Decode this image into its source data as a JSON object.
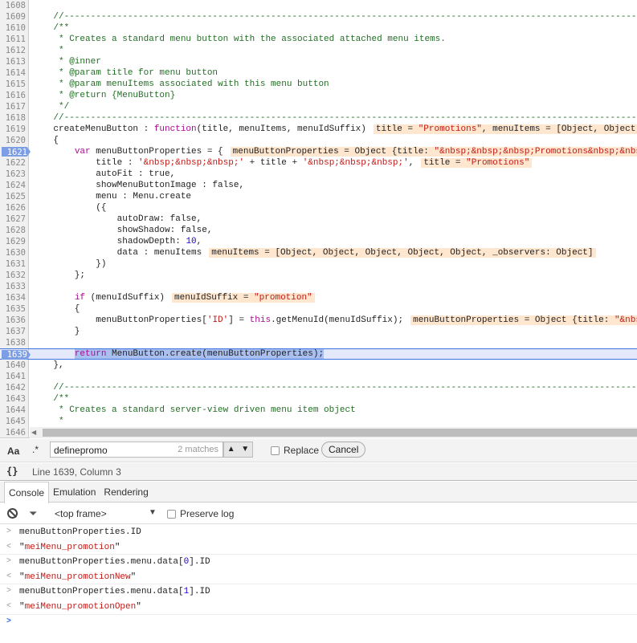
{
  "editor": {
    "lines": [
      {
        "num": "1608",
        "code": []
      },
      {
        "num": "1609",
        "code": [
          [
            "    //-------------------------------------------------------------------------------------------------------------------",
            "c"
          ]
        ]
      },
      {
        "num": "1610",
        "code": [
          [
            "    /**",
            "c"
          ]
        ]
      },
      {
        "num": "1611",
        "code": [
          [
            "     * Creates a standard menu button with the associated attached menu items.",
            "c"
          ]
        ]
      },
      {
        "num": "1612",
        "code": [
          [
            "     *",
            "c"
          ]
        ]
      },
      {
        "num": "1613",
        "code": [
          [
            "     * @inner",
            "c"
          ]
        ]
      },
      {
        "num": "1614",
        "code": [
          [
            "     * @param title for menu button",
            "c"
          ]
        ]
      },
      {
        "num": "1615",
        "code": [
          [
            "     * @param menuItems associated with this menu button",
            "c"
          ]
        ]
      },
      {
        "num": "1616",
        "code": [
          [
            "     * @return {MenuButton}",
            "c"
          ]
        ]
      },
      {
        "num": "1617",
        "code": [
          [
            "     */",
            "c"
          ]
        ]
      },
      {
        "num": "1618",
        "code": [
          [
            "    //-------------------------------------------------------------------------------------------------------------------",
            "c"
          ]
        ]
      },
      {
        "num": "1619",
        "code": [
          [
            "    createMenuButton : ",
            "p"
          ],
          [
            "function",
            "k"
          ],
          [
            "(title, menuItems, menuIdSuffix)",
            "p"
          ]
        ],
        "value": [
          [
            "title = ",
            "p"
          ],
          [
            "\"Promotions\"",
            "s"
          ],
          [
            ", menuItems = [Object, Object, Object, Object, Object, _observers: Object]",
            "p"
          ]
        ]
      },
      {
        "num": "1620",
        "code": [
          [
            "    {",
            "p"
          ]
        ]
      },
      {
        "num": "1621",
        "breakpoint": true,
        "code": [
          [
            "        ",
            "p"
          ],
          [
            "var",
            "k"
          ],
          [
            " menuButtonProperties = {",
            "p"
          ]
        ],
        "value": [
          [
            "menuButtonProperties = Object {title: ",
            "p"
          ],
          [
            "\"&nbsp;&nbsp;&nbsp;Promotions&nbsp;&nbsp;&nbsp;\"",
            "s"
          ]
        ]
      },
      {
        "num": "1622",
        "code": [
          [
            "            title : ",
            "p"
          ],
          [
            "'&nbsp;&nbsp;&nbsp;'",
            "s"
          ],
          [
            " + title + ",
            "p"
          ],
          [
            "'&nbsp;&nbsp;&nbsp;'",
            "s"
          ],
          [
            ",",
            "p"
          ]
        ],
        "value": [
          [
            "title = ",
            "p"
          ],
          [
            "\"Promotions\"",
            "s"
          ]
        ]
      },
      {
        "num": "1623",
        "code": [
          [
            "            autoFit : true,",
            "p"
          ]
        ]
      },
      {
        "num": "1624",
        "code": [
          [
            "            showMenuButtonImage : false,",
            "p"
          ]
        ]
      },
      {
        "num": "1625",
        "code": [
          [
            "            menu : Menu.create",
            "p"
          ]
        ]
      },
      {
        "num": "1626",
        "code": [
          [
            "            ({",
            "p"
          ]
        ]
      },
      {
        "num": "1627",
        "code": [
          [
            "                autoDraw: false,",
            "p"
          ]
        ]
      },
      {
        "num": "1628",
        "code": [
          [
            "                showShadow: false,",
            "p"
          ]
        ]
      },
      {
        "num": "1629",
        "code": [
          [
            "                shadowDepth: ",
            "p"
          ],
          [
            "10",
            "n"
          ],
          [
            ",",
            "p"
          ]
        ]
      },
      {
        "num": "1630",
        "code": [
          [
            "                data : menuItems",
            "p"
          ]
        ],
        "value": [
          [
            "menuItems = [Object, Object, Object, Object, Object, _observers: Object]",
            "p"
          ]
        ]
      },
      {
        "num": "1631",
        "code": [
          [
            "            })",
            "p"
          ]
        ]
      },
      {
        "num": "1632",
        "code": [
          [
            "        };",
            "p"
          ]
        ]
      },
      {
        "num": "1633",
        "code": []
      },
      {
        "num": "1634",
        "code": [
          [
            "        ",
            "p"
          ],
          [
            "if",
            "k"
          ],
          [
            " (menuIdSuffix)",
            "p"
          ]
        ],
        "value": [
          [
            "menuIdSuffix = ",
            "p"
          ],
          [
            "\"promotion\"",
            "s"
          ]
        ]
      },
      {
        "num": "1635",
        "code": [
          [
            "        {",
            "p"
          ]
        ]
      },
      {
        "num": "1636",
        "code": [
          [
            "            menuButtonProperties[",
            "p"
          ],
          [
            "'ID'",
            "s"
          ],
          [
            "] = ",
            "p"
          ],
          [
            "this",
            "k"
          ],
          [
            ".getMenuId(menuIdSuffix);",
            "p"
          ]
        ],
        "value": [
          [
            "menuButtonProperties = Object {title: ",
            "p"
          ],
          [
            "\"&nbsp;&nbsp;&nbsp;Promotions\"",
            "s"
          ]
        ]
      },
      {
        "num": "1637",
        "code": [
          [
            "        }",
            "p"
          ]
        ]
      },
      {
        "num": "1638",
        "code": []
      },
      {
        "num": "1639",
        "breakpoint": true,
        "current": true,
        "code": [
          [
            "        ",
            "p"
          ],
          [
            "return",
            "k sel"
          ],
          [
            " MenuButton.create(menuButtonProperties);",
            "p sel"
          ]
        ]
      },
      {
        "num": "1640",
        "code": [
          [
            "    },",
            "p"
          ]
        ]
      },
      {
        "num": "1641",
        "code": []
      },
      {
        "num": "1642",
        "code": [
          [
            "    //-------------------------------------------------------------------------------------------------------------------",
            "c"
          ]
        ]
      },
      {
        "num": "1643",
        "code": [
          [
            "    /**",
            "c"
          ]
        ]
      },
      {
        "num": "1644",
        "code": [
          [
            "     * Creates a standard server-view driven menu item object",
            "c"
          ]
        ]
      },
      {
        "num": "1645",
        "code": [
          [
            "     *",
            "c"
          ]
        ]
      },
      {
        "num": "1646",
        "code": []
      }
    ]
  },
  "search": {
    "case_label": "Aa",
    "regex_label": ".*",
    "query": "definepromo",
    "matches": "2 matches",
    "replace_label": "Replace",
    "cancel_label": "Cancel"
  },
  "status": {
    "format_icon": "{}",
    "position": "Line 1639, Column 3"
  },
  "drawer_tabs": [
    {
      "label": "Console",
      "active": true
    },
    {
      "label": "Emulation"
    },
    {
      "label": "Rendering"
    }
  ],
  "console_toolbar": {
    "frame": "<top frame>",
    "preserve_log": "Preserve log"
  },
  "console": [
    {
      "type": "in",
      "parts": [
        [
          "menuButtonProperties.ID",
          "p"
        ]
      ]
    },
    {
      "type": "out",
      "parts": [
        [
          "\"",
          "p"
        ],
        [
          "meiMenu_promotion",
          "s"
        ],
        [
          "\"",
          "p"
        ]
      ]
    },
    {
      "type": "in",
      "parts": [
        [
          "menuButtonProperties.menu.data[",
          "p"
        ],
        [
          "0",
          "n"
        ],
        [
          "].ID",
          "p"
        ]
      ]
    },
    {
      "type": "out",
      "parts": [
        [
          "\"",
          "p"
        ],
        [
          "meiMenu_promotionNew",
          "s"
        ],
        [
          "\"",
          "p"
        ]
      ]
    },
    {
      "type": "in",
      "parts": [
        [
          "menuButtonProperties.menu.data[",
          "p"
        ],
        [
          "1",
          "n"
        ],
        [
          "].ID",
          "p"
        ]
      ]
    },
    {
      "type": "out",
      "parts": [
        [
          "\"",
          "p"
        ],
        [
          "meiMenu_promotionOpen",
          "s"
        ],
        [
          "\"",
          "p"
        ]
      ]
    }
  ],
  "colors": {
    "comment": "#236e25",
    "keyword": "#aa0d91",
    "string": "#c41a16",
    "number": "#1c00cf",
    "inline_value_bg": "#ffe6cf",
    "current_line": "#e3e9fa",
    "breakpoint": "#7c9ee6"
  }
}
